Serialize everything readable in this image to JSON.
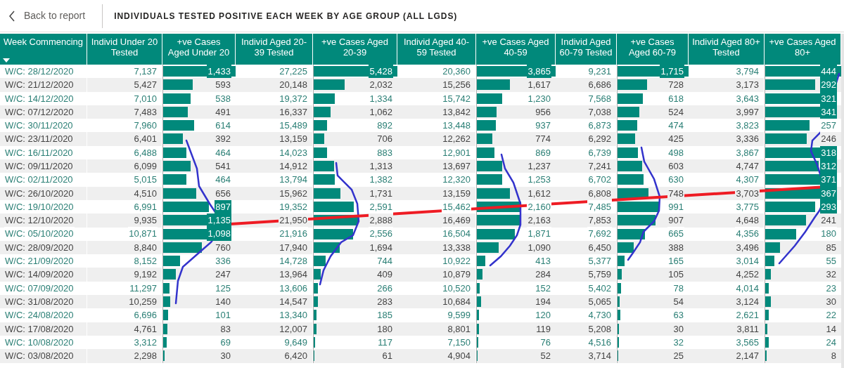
{
  "header": {
    "back_link": "Back to report",
    "title": "INDIVIDUALS TESTED POSITIVE EACH WEEK BY AGE GROUP (ALL LGDS)"
  },
  "table": {
    "columns": [
      {
        "label": "Week Commencing",
        "kind": "text",
        "sorted": true
      },
      {
        "label": "Individ Under 20 Tested",
        "kind": "number",
        "sorted": false
      },
      {
        "label": "+ve Cases Aged Under 20",
        "kind": "bar",
        "sorted": false
      },
      {
        "label": "Individ Aged 20-39 Tested",
        "kind": "number",
        "sorted": false
      },
      {
        "label": "+ve Cases Aged 20-39",
        "kind": "bar",
        "sorted": false
      },
      {
        "label": "Individ Aged 40-59 Tested",
        "kind": "number",
        "sorted": false
      },
      {
        "label": "+ve Cases Aged 40-59",
        "kind": "bar",
        "sorted": false
      },
      {
        "label": "Individ Aged 60-79 Tested",
        "kind": "number",
        "sorted": false
      },
      {
        "label": "+ve Cases Aged 60-79",
        "kind": "bar",
        "sorted": false
      },
      {
        "label": "Individ Aged 80+ Tested",
        "kind": "number",
        "sorted": false
      },
      {
        "label": "+ve Cases Aged 80+",
        "kind": "bar",
        "sorted": false
      }
    ],
    "rows": [
      {
        "cells": [
          {
            "value": "W/C: 28/12/2020"
          },
          {
            "value": "7,137"
          },
          {
            "value": "1,433",
            "level": 1
          },
          {
            "value": "27,225"
          },
          {
            "value": "5,428",
            "level": 1
          },
          {
            "value": "20,360"
          },
          {
            "value": "3,865",
            "level": 1
          },
          {
            "value": "9,231"
          },
          {
            "value": "1,715",
            "level": 1
          },
          {
            "value": "3,794"
          },
          {
            "value": "444",
            "level": 1
          }
        ]
      },
      {
        "cells": [
          {
            "value": "W/C: 21/12/2020"
          },
          {
            "value": "5,427"
          },
          {
            "value": "593",
            "level": 0.41
          },
          {
            "value": "20,148"
          },
          {
            "value": "2,032",
            "level": 0.37
          },
          {
            "value": "15,256"
          },
          {
            "value": "1,617",
            "level": 0.42
          },
          {
            "value": "6,686"
          },
          {
            "value": "728",
            "level": 0.42
          },
          {
            "value": "3,173"
          },
          {
            "value": "292",
            "level": 0.66
          }
        ]
      },
      {
        "cells": [
          {
            "value": "W/C: 14/12/2020"
          },
          {
            "value": "7,010"
          },
          {
            "value": "538",
            "level": 0.38
          },
          {
            "value": "19,372"
          },
          {
            "value": "1,334",
            "level": 0.25
          },
          {
            "value": "15,742"
          },
          {
            "value": "1,230",
            "level": 0.32
          },
          {
            "value": "7,568"
          },
          {
            "value": "618",
            "level": 0.36
          },
          {
            "value": "3,643"
          },
          {
            "value": "321",
            "level": 0.72
          }
        ]
      },
      {
        "cells": [
          {
            "value": "W/C: 07/12/2020"
          },
          {
            "value": "7,483"
          },
          {
            "value": "491",
            "level": 0.34
          },
          {
            "value": "16,337"
          },
          {
            "value": "1,062",
            "level": 0.2
          },
          {
            "value": "13,842"
          },
          {
            "value": "956",
            "level": 0.25
          },
          {
            "value": "7,038"
          },
          {
            "value": "524",
            "level": 0.31
          },
          {
            "value": "3,997"
          },
          {
            "value": "341",
            "level": 0.77
          }
        ]
      },
      {
        "cells": [
          {
            "value": "W/C: 30/11/2020"
          },
          {
            "value": "7,960"
          },
          {
            "value": "614",
            "level": 0.43
          },
          {
            "value": "15,489"
          },
          {
            "value": "892",
            "level": 0.16
          },
          {
            "value": "13,448"
          },
          {
            "value": "937",
            "level": 0.24
          },
          {
            "value": "6,873"
          },
          {
            "value": "474",
            "level": 0.28
          },
          {
            "value": "3,823"
          },
          {
            "value": "257",
            "level": 0.58
          }
        ]
      },
      {
        "cells": [
          {
            "value": "W/C: 23/11/2020"
          },
          {
            "value": "6,401"
          },
          {
            "value": "392",
            "level": 0.27
          },
          {
            "value": "13,159"
          },
          {
            "value": "706",
            "level": 0.13
          },
          {
            "value": "12,262"
          },
          {
            "value": "774",
            "level": 0.2
          },
          {
            "value": "6,292"
          },
          {
            "value": "425",
            "level": 0.25
          },
          {
            "value": "3,336"
          },
          {
            "value": "246",
            "level": 0.55
          }
        ]
      },
      {
        "cells": [
          {
            "value": "W/C: 16/11/2020"
          },
          {
            "value": "6,488"
          },
          {
            "value": "464",
            "level": 0.32
          },
          {
            "value": "14,023"
          },
          {
            "value": "883",
            "level": 0.16
          },
          {
            "value": "12,901"
          },
          {
            "value": "869",
            "level": 0.22
          },
          {
            "value": "6,739"
          },
          {
            "value": "498",
            "level": 0.29
          },
          {
            "value": "3,867"
          },
          {
            "value": "318",
            "level": 0.72
          }
        ]
      },
      {
        "cells": [
          {
            "value": "W/C: 09/11/2020"
          },
          {
            "value": "6,099"
          },
          {
            "value": "541",
            "level": 0.38
          },
          {
            "value": "14,912"
          },
          {
            "value": "1,313",
            "level": 0.24
          },
          {
            "value": "13,697"
          },
          {
            "value": "1,237",
            "level": 0.32
          },
          {
            "value": "7,241"
          },
          {
            "value": "603",
            "level": 0.35
          },
          {
            "value": "4,747"
          },
          {
            "value": "312",
            "level": 0.7
          }
        ]
      },
      {
        "cells": [
          {
            "value": "W/C: 02/11/2020"
          },
          {
            "value": "5,015"
          },
          {
            "value": "464",
            "level": 0.32
          },
          {
            "value": "13,794"
          },
          {
            "value": "1,382",
            "level": 0.25
          },
          {
            "value": "12,320"
          },
          {
            "value": "1,253",
            "level": 0.32
          },
          {
            "value": "6,702"
          },
          {
            "value": "630",
            "level": 0.37
          },
          {
            "value": "4,307"
          },
          {
            "value": "371",
            "level": 0.84
          }
        ]
      },
      {
        "cells": [
          {
            "value": "W/C: 26/10/2020"
          },
          {
            "value": "4,510"
          },
          {
            "value": "656",
            "level": 0.46
          },
          {
            "value": "15,962"
          },
          {
            "value": "1,731",
            "level": 0.32
          },
          {
            "value": "13,159"
          },
          {
            "value": "1,612",
            "level": 0.42
          },
          {
            "value": "6,808"
          },
          {
            "value": "748",
            "level": 0.44
          },
          {
            "value": "3,703"
          },
          {
            "value": "367",
            "level": 0.83
          }
        ]
      },
      {
        "cells": [
          {
            "value": "W/C: 19/10/2020"
          },
          {
            "value": "6,991"
          },
          {
            "value": "897",
            "level": 0.63
          },
          {
            "value": "19,352"
          },
          {
            "value": "2,591",
            "level": 0.48
          },
          {
            "value": "15,462"
          },
          {
            "value": "2,160",
            "level": 0.56
          },
          {
            "value": "7,485"
          },
          {
            "value": "991",
            "level": 0.58
          },
          {
            "value": "3,775"
          },
          {
            "value": "293",
            "level": 0.66
          }
        ]
      },
      {
        "cells": [
          {
            "value": "W/C: 12/10/2020"
          },
          {
            "value": "9,935"
          },
          {
            "value": "1,135",
            "level": 0.79
          },
          {
            "value": "21,950"
          },
          {
            "value": "2,888",
            "level": 0.53
          },
          {
            "value": "16,469"
          },
          {
            "value": "2,163",
            "level": 0.56
          },
          {
            "value": "7,853"
          },
          {
            "value": "907",
            "level": 0.53
          },
          {
            "value": "4,648"
          },
          {
            "value": "241",
            "level": 0.54
          }
        ]
      },
      {
        "cells": [
          {
            "value": "W/C: 05/10/2020"
          },
          {
            "value": "10,871"
          },
          {
            "value": "1,098",
            "level": 0.77
          },
          {
            "value": "21,916"
          },
          {
            "value": "2,556",
            "level": 0.47
          },
          {
            "value": "16,504"
          },
          {
            "value": "1,871",
            "level": 0.48
          },
          {
            "value": "7,692"
          },
          {
            "value": "665",
            "level": 0.39
          },
          {
            "value": "4,356"
          },
          {
            "value": "180",
            "level": 0.41
          }
        ]
      },
      {
        "cells": [
          {
            "value": "W/C: 28/09/2020"
          },
          {
            "value": "8,840"
          },
          {
            "value": "760",
            "level": 0.53
          },
          {
            "value": "17,940"
          },
          {
            "value": "1,694",
            "level": 0.31
          },
          {
            "value": "13,338"
          },
          {
            "value": "1,090",
            "level": 0.28
          },
          {
            "value": "6,450"
          },
          {
            "value": "388",
            "level": 0.23
          },
          {
            "value": "3,496"
          },
          {
            "value": "85",
            "level": 0.19
          }
        ]
      },
      {
        "cells": [
          {
            "value": "W/C: 21/09/2020"
          },
          {
            "value": "8,152"
          },
          {
            "value": "336",
            "level": 0.23
          },
          {
            "value": "14,728"
          },
          {
            "value": "744",
            "level": 0.14
          },
          {
            "value": "10,922"
          },
          {
            "value": "413",
            "level": 0.11
          },
          {
            "value": "5,377"
          },
          {
            "value": "165",
            "level": 0.1
          },
          {
            "value": "3,014"
          },
          {
            "value": "55",
            "level": 0.12
          }
        ]
      },
      {
        "cells": [
          {
            "value": "W/C: 14/09/2020"
          },
          {
            "value": "9,192"
          },
          {
            "value": "247",
            "level": 0.17
          },
          {
            "value": "13,964"
          },
          {
            "value": "409",
            "level": 0.08
          },
          {
            "value": "10,879"
          },
          {
            "value": "284",
            "level": 0.07
          },
          {
            "value": "5,759"
          },
          {
            "value": "105",
            "level": 0.06
          },
          {
            "value": "4,252"
          },
          {
            "value": "32",
            "level": 0.07
          }
        ]
      },
      {
        "cells": [
          {
            "value": "W/C: 07/09/2020"
          },
          {
            "value": "11,297"
          },
          {
            "value": "125",
            "level": 0.09
          },
          {
            "value": "13,606"
          },
          {
            "value": "266",
            "level": 0.05
          },
          {
            "value": "10,520"
          },
          {
            "value": "152",
            "level": 0.04
          },
          {
            "value": "5,402"
          },
          {
            "value": "78",
            "level": 0.05
          },
          {
            "value": "4,014"
          },
          {
            "value": "23",
            "level": 0.05
          }
        ]
      },
      {
        "cells": [
          {
            "value": "W/C: 31/08/2020"
          },
          {
            "value": "10,259"
          },
          {
            "value": "140",
            "level": 0.1
          },
          {
            "value": "14,547"
          },
          {
            "value": "283",
            "level": 0.05
          },
          {
            "value": "10,684"
          },
          {
            "value": "194",
            "level": 0.05
          },
          {
            "value": "5,065"
          },
          {
            "value": "54",
            "level": 0.03
          },
          {
            "value": "3,124"
          },
          {
            "value": "30",
            "level": 0.07
          }
        ]
      },
      {
        "cells": [
          {
            "value": "W/C: 24/08/2020"
          },
          {
            "value": "6,696"
          },
          {
            "value": "101",
            "level": 0.07
          },
          {
            "value": "13,340"
          },
          {
            "value": "185",
            "level": 0.03
          },
          {
            "value": "9,599"
          },
          {
            "value": "120",
            "level": 0.03
          },
          {
            "value": "4,730"
          },
          {
            "value": "63",
            "level": 0.04
          },
          {
            "value": "2,621"
          },
          {
            "value": "22",
            "level": 0.05
          }
        ]
      },
      {
        "cells": [
          {
            "value": "W/C: 17/08/2020"
          },
          {
            "value": "4,761"
          },
          {
            "value": "83",
            "level": 0.06
          },
          {
            "value": "12,007"
          },
          {
            "value": "180",
            "level": 0.03
          },
          {
            "value": "8,801"
          },
          {
            "value": "119",
            "level": 0.03
          },
          {
            "value": "5,208"
          },
          {
            "value": "30",
            "level": 0.02
          },
          {
            "value": "3,811"
          },
          {
            "value": "14",
            "level": 0.03
          }
        ]
      },
      {
        "cells": [
          {
            "value": "W/C: 10/08/2020"
          },
          {
            "value": "3,312"
          },
          {
            "value": "69",
            "level": 0.05
          },
          {
            "value": "9,649"
          },
          {
            "value": "117",
            "level": 0.02
          },
          {
            "value": "7,150"
          },
          {
            "value": "76",
            "level": 0.02
          },
          {
            "value": "4,516"
          },
          {
            "value": "32",
            "level": 0.02
          },
          {
            "value": "3,565"
          },
          {
            "value": "24",
            "level": 0.05
          }
        ]
      },
      {
        "cells": [
          {
            "value": "W/C: 03/08/2020"
          },
          {
            "value": "2,298"
          },
          {
            "value": "30",
            "level": 0.02
          },
          {
            "value": "6,420"
          },
          {
            "value": "61",
            "level": 0.01
          },
          {
            "value": "4,904"
          },
          {
            "value": "52",
            "level": 0.01
          },
          {
            "value": "3,714"
          },
          {
            "value": "25",
            "level": 0.01
          },
          {
            "value": "2,147"
          },
          {
            "value": "8",
            "level": 0.02
          }
        ]
      }
    ]
  }
}
